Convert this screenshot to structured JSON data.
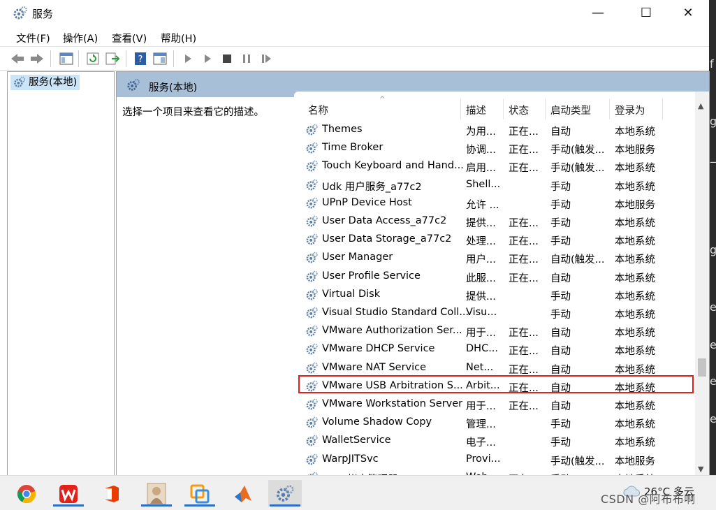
{
  "window": {
    "title": "服务",
    "controls": [
      "—",
      "☐",
      "✕"
    ]
  },
  "right_strip": [
    "f",
    "g",
    "—",
    "g",
    "e",
    "e",
    "e",
    "e"
  ],
  "menu": [
    "文件(F)",
    "操作(A)",
    "查看(V)",
    "帮助(H)"
  ],
  "tree": {
    "root_label": "服务(本地)"
  },
  "pane": {
    "title": "服务(本地)",
    "description": "选择一个项目来查看它的描述。"
  },
  "columns": {
    "name": "名称",
    "desc": "描述",
    "status": "状态",
    "startup": "启动类型",
    "logon": "登录为"
  },
  "services": [
    {
      "name": "Themes",
      "desc": "为用...",
      "status": "正在...",
      "startup": "自动",
      "logon": "本地系统"
    },
    {
      "name": "Time Broker",
      "desc": "协调...",
      "status": "正在...",
      "startup": "手动(触发...",
      "logon": "本地服务"
    },
    {
      "name": "Touch Keyboard and Hand...",
      "desc": "启用...",
      "status": "正在...",
      "startup": "手动(触发...",
      "logon": "本地系统"
    },
    {
      "name": "Udk 用户服务_a77c2",
      "desc": "Shell...",
      "status": "",
      "startup": "手动",
      "logon": "本地系统"
    },
    {
      "name": "UPnP Device Host",
      "desc": "允许 ...",
      "status": "",
      "startup": "手动",
      "logon": "本地服务"
    },
    {
      "name": "User Data Access_a77c2",
      "desc": "提供...",
      "status": "正在...",
      "startup": "手动",
      "logon": "本地系统"
    },
    {
      "name": "User Data Storage_a77c2",
      "desc": "处理...",
      "status": "正在...",
      "startup": "手动",
      "logon": "本地系统"
    },
    {
      "name": "User Manager",
      "desc": "用户...",
      "status": "正在...",
      "startup": "自动(触发...",
      "logon": "本地系统"
    },
    {
      "name": "User Profile Service",
      "desc": "此服...",
      "status": "正在...",
      "startup": "自动",
      "logon": "本地系统"
    },
    {
      "name": "Virtual Disk",
      "desc": "提供...",
      "status": "",
      "startup": "手动",
      "logon": "本地系统"
    },
    {
      "name": "Visual Studio Standard Coll...",
      "desc": "Visu...",
      "status": "",
      "startup": "手动",
      "logon": "本地系统"
    },
    {
      "name": "VMware Authorization Ser...",
      "desc": "用于...",
      "status": "正在...",
      "startup": "自动",
      "logon": "本地系统"
    },
    {
      "name": "VMware DHCP Service",
      "desc": "DHC...",
      "status": "正在...",
      "startup": "自动",
      "logon": "本地系统"
    },
    {
      "name": "VMware NAT Service",
      "desc": "Net...",
      "status": "正在...",
      "startup": "自动",
      "logon": "本地系统"
    },
    {
      "name": "VMware USB Arbitration S...",
      "desc": "Arbit...",
      "status": "正在...",
      "startup": "自动",
      "logon": "本地系统"
    },
    {
      "name": "VMware Workstation Server",
      "desc": "用于...",
      "status": "正在...",
      "startup": "自动",
      "logon": "本地系统"
    },
    {
      "name": "Volume Shadow Copy",
      "desc": "管理...",
      "status": "",
      "startup": "手动",
      "logon": "本地系统"
    },
    {
      "name": "WalletService",
      "desc": "电子...",
      "status": "",
      "startup": "手动",
      "logon": "本地系统"
    },
    {
      "name": "WarpJITSvc",
      "desc": "Provi...",
      "status": "",
      "startup": "手动(触发...",
      "logon": "本地服务"
    },
    {
      "name": "Web 帐户管理器",
      "desc": "Web...",
      "status": "正在...",
      "startup": "手动",
      "logon": "本地系统"
    }
  ],
  "taskbar": {
    "apps": [
      "chrome-icon",
      "wps-icon",
      "office-icon",
      "photo-icon",
      "vmware-icon",
      "matlab-icon",
      "services-icon"
    ],
    "weather": "26°C 多云",
    "watermark": "CSDN @阿布布啊"
  }
}
